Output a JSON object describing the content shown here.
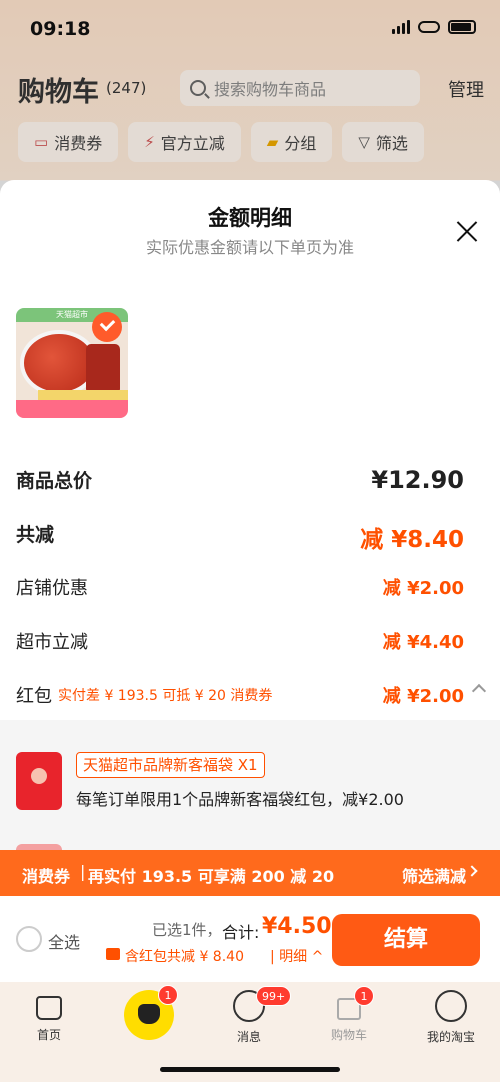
{
  "status": {
    "time": "09:18"
  },
  "cart": {
    "title": "购物车",
    "count": "(247)",
    "search_placeholder": "搜索购物车商品",
    "manage": "管理",
    "filters": [
      "消费券",
      "官方立减",
      "分组",
      "筛选"
    ]
  },
  "sheet": {
    "title": "金额明细",
    "subtitle": "实际优惠金额请以下单页为准",
    "product_image_labels": [
      "天猫超市",
      "正品保障",
      "辣度适中"
    ],
    "rows": {
      "total_price": {
        "label": "商品总价",
        "value": "¥12.90"
      },
      "total_reduce": {
        "label": "共减",
        "value": "减 ¥8.40"
      },
      "shop_discount": {
        "label": "店铺优惠",
        "value": "减 ¥2.00"
      },
      "market_reduce": {
        "label": "超市立减",
        "value": "减 ¥4.40"
      },
      "red_packet": {
        "label": "红包",
        "hint": "实付差 ¥ 193.5 可抵 ¥ 20 消费券",
        "value": "减 ¥2.00"
      }
    },
    "packet": {
      "tag": "天猫超市品牌新客福袋 X1",
      "description": "每笔订单限用1个品牌新客福袋红包，减¥2.00"
    }
  },
  "coupon_bar": {
    "label": "消费券",
    "separator": "|",
    "message": "再实付 193.5 可享满 200 减 20",
    "action": "筛选满减"
  },
  "checkout": {
    "select_all": "全选",
    "selected": "已选1件，",
    "total_label": "合计:",
    "total_value": "¥4.50",
    "red_info": "含红包共减 ¥ 8.40",
    "detail": "| 明细 ^",
    "pay_button": "结算"
  },
  "tabbar": {
    "items": [
      {
        "label": "首页"
      },
      {
        "label": ""
      },
      {
        "label": "消息",
        "badge": "99+"
      },
      {
        "label": "购物车",
        "badge": "1"
      },
      {
        "label": "我的淘宝"
      }
    ],
    "pet_badge": "1"
  },
  "colors": {
    "accent": "#ff5000",
    "coupon_bar": "#ff6a1c",
    "pay_button": "#ff5a14"
  }
}
